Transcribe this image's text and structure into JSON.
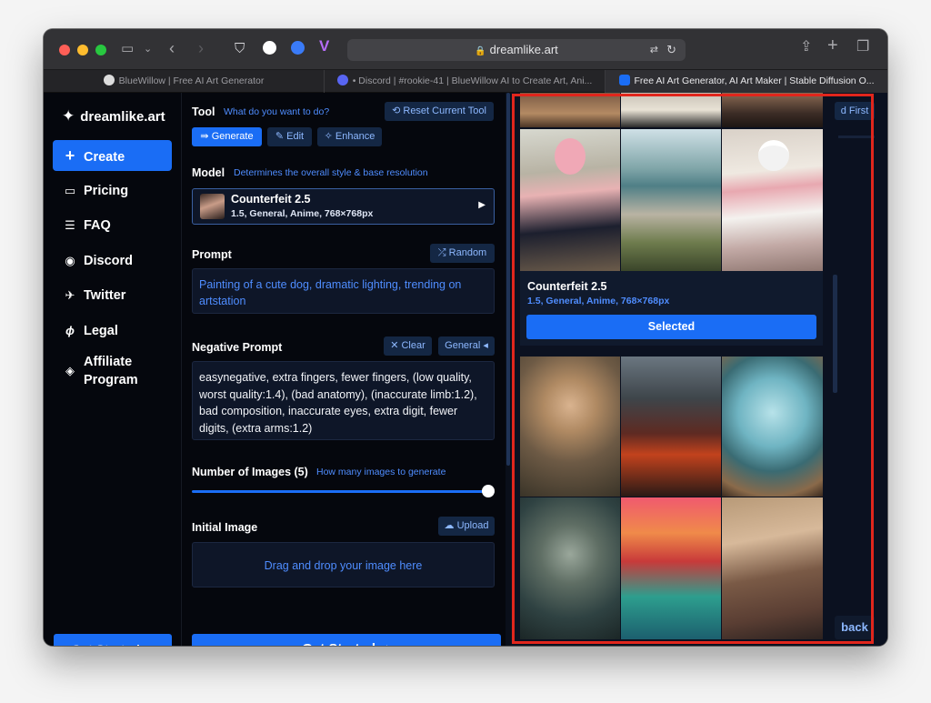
{
  "browser": {
    "url": "dreamlike.art",
    "tabs": [
      {
        "title": "BlueWillow | Free AI Art Generator"
      },
      {
        "title": "• Discord | #rookie-41 | BlueWillow AI to Create Art, Ani..."
      },
      {
        "title": "Free AI Art Generator, AI Art Maker | Stable Diffusion O..."
      }
    ]
  },
  "sidebar": {
    "logo": "dreamlike.art",
    "items": [
      {
        "label": "Create",
        "icon": "plus-icon"
      },
      {
        "label": "Pricing",
        "icon": "card-icon"
      },
      {
        "label": "FAQ",
        "icon": "list-icon"
      },
      {
        "label": "Discord",
        "icon": "discord-icon"
      },
      {
        "label": "Twitter",
        "icon": "twitter-icon"
      },
      {
        "label": "Legal",
        "icon": "feather-icon"
      },
      {
        "label": "Affiliate\nProgram",
        "icon": "diamond-icon"
      }
    ],
    "cta": "Get Started ⇨"
  },
  "tool": {
    "label": "Tool",
    "hint": "What do you want to do?",
    "reset": "Reset Current Tool",
    "generate": "Generate",
    "edit": "Edit",
    "enhance": "Enhance"
  },
  "model": {
    "label": "Model",
    "hint": "Determines the overall style & base resolution",
    "name": "Counterfeit 2.5",
    "desc": "1.5, General, Anime, 768×768px"
  },
  "prompt": {
    "label": "Prompt",
    "random": "Random",
    "value": "Painting of a cute dog, dramatic lighting, trending on artstation"
  },
  "negative": {
    "label": "Negative Prompt",
    "clear": "Clear",
    "general": "General ◂",
    "value": "easynegative, extra fingers, fewer fingers, (low quality, worst quality:1.4), (bad anatomy), (inaccurate limb:1.2), bad composition, inaccurate eyes, extra digit, fewer digits, (extra arms:1.2)"
  },
  "images": {
    "label": "Number of Images (5)",
    "hint": "How many images to generate",
    "value_fraction": 1.0
  },
  "initial": {
    "label": "Initial Image",
    "upload": "Upload",
    "drop": "Drag and drop your image here"
  },
  "main_cta": "Get Started ⇨",
  "model_card": {
    "name": "Counterfeit 2.5",
    "desc": "1.5, General, Anime, 768×768px",
    "selected": "Selected"
  },
  "behind": {
    "first": "d First",
    "back": "back"
  },
  "colors": {
    "accent": "#1a6df5",
    "highlight_border": "#e1261c"
  }
}
